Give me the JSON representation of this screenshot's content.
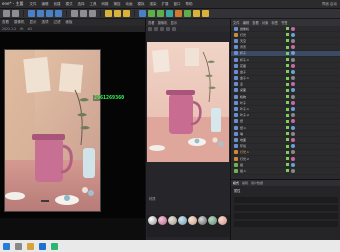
{
  "window": {
    "title": "ene* - 主要"
  },
  "menu": [
    "文件",
    "编辑",
    "创建",
    "模式",
    "选择",
    "工具",
    "网格",
    "捕捉",
    "动画",
    "模拟",
    "渲染",
    "扩展",
    "窗口",
    "帮助"
  ],
  "right_menu": "界面 启动",
  "left_viewport": {
    "header": [
      "查看",
      "摄像机",
      "显示",
      "选项",
      "过滤",
      "面板"
    ],
    "sub_header": [
      "2022.1.2",
      "fit",
      "#2"
    ],
    "hud_text": "2961269360"
  },
  "center_viewport": {
    "header": [
      "查看",
      "摄像机",
      "显示"
    ],
    "label": "材质"
  },
  "object_manager": {
    "header": [
      "文件",
      "编辑",
      "查看",
      "对象",
      "标签",
      "书签"
    ],
    "items": [
      {
        "name": "摄像机",
        "icon": "camera-icon"
      },
      {
        "name": "灯光",
        "icon": "light-icon"
      },
      {
        "name": "天空",
        "icon": "sky-icon"
      },
      {
        "name": "背景",
        "icon": "object-icon"
      },
      {
        "name": "杯子",
        "icon": "object-icon"
      },
      {
        "name": "杯子.1",
        "icon": "object-icon"
      },
      {
        "name": "花瓶",
        "icon": "object-icon"
      },
      {
        "name": "盘子",
        "icon": "object-icon"
      },
      {
        "name": "盘子.1",
        "icon": "object-icon"
      },
      {
        "name": "壶",
        "icon": "object-icon"
      },
      {
        "name": "桌面",
        "icon": "object-icon"
      },
      {
        "name": "植物",
        "icon": "object-icon"
      },
      {
        "name": "叶子",
        "icon": "object-icon"
      },
      {
        "name": "叶子.1",
        "icon": "object-icon"
      },
      {
        "name": "叶子.2",
        "icon": "object-icon"
      },
      {
        "name": "纸",
        "icon": "object-icon"
      },
      {
        "name": "纸.1",
        "icon": "object-icon"
      },
      {
        "name": "墙",
        "icon": "object-icon"
      },
      {
        "name": "地面",
        "icon": "object-icon"
      },
      {
        "name": "环境",
        "icon": "object-icon"
      },
      {
        "name": "灯光.1",
        "icon": "light-icon"
      },
      {
        "name": "灯光.2",
        "icon": "light-icon"
      },
      {
        "name": "组",
        "icon": "null-icon"
      },
      {
        "name": "组.1",
        "icon": "null-icon"
      }
    ]
  },
  "attributes": {
    "tabs": [
      "模式",
      "编辑",
      "用户数据"
    ],
    "title": "属性"
  },
  "colors": {
    "hud": "#39ff5a",
    "accent": "#d9b23a",
    "selection": "#3d4a63"
  }
}
